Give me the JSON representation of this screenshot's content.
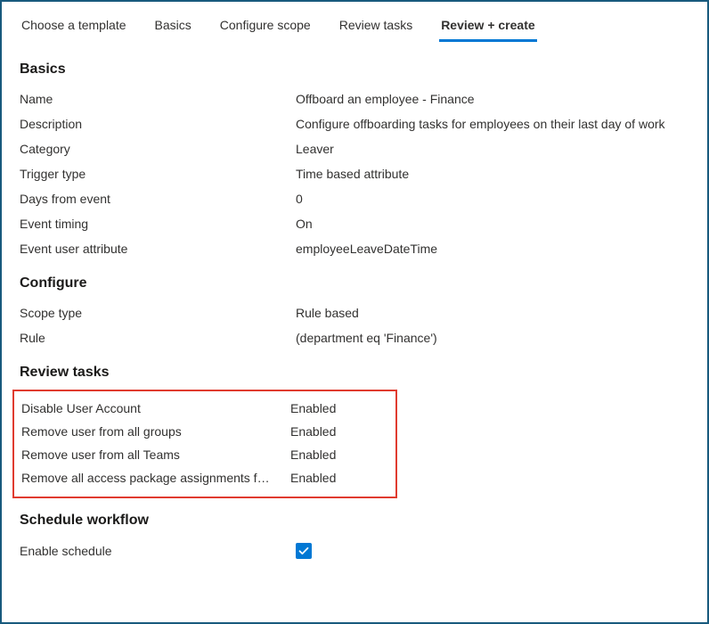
{
  "tabs": [
    {
      "label": "Choose a template"
    },
    {
      "label": "Basics"
    },
    {
      "label": "Configure scope"
    },
    {
      "label": "Review tasks"
    },
    {
      "label": "Review + create"
    }
  ],
  "sections": {
    "basics": {
      "title": "Basics",
      "rows": [
        {
          "label": "Name",
          "value": "Offboard an employee - Finance"
        },
        {
          "label": "Description",
          "value": "Configure offboarding tasks for employees on their last day of work"
        },
        {
          "label": "Category",
          "value": "Leaver"
        },
        {
          "label": "Trigger type",
          "value": "Time based attribute"
        },
        {
          "label": "Days from event",
          "value": "0"
        },
        {
          "label": "Event timing",
          "value": "On"
        },
        {
          "label": "Event user attribute",
          "value": "employeeLeaveDateTime"
        }
      ]
    },
    "configure": {
      "title": "Configure",
      "rows": [
        {
          "label": "Scope type",
          "value": "Rule based"
        },
        {
          "label": "Rule",
          "value": " (department eq 'Finance')"
        }
      ]
    },
    "review_tasks": {
      "title": "Review tasks",
      "rows": [
        {
          "label": "Disable User Account",
          "value": "Enabled"
        },
        {
          "label": "Remove user from all groups",
          "value": "Enabled"
        },
        {
          "label": "Remove user from all Teams",
          "value": "Enabled"
        },
        {
          "label": "Remove all access package assignments f…",
          "value": "Enabled"
        }
      ]
    },
    "schedule": {
      "title": "Schedule workflow",
      "enable_label": "Enable schedule",
      "enable_checked": true
    }
  }
}
